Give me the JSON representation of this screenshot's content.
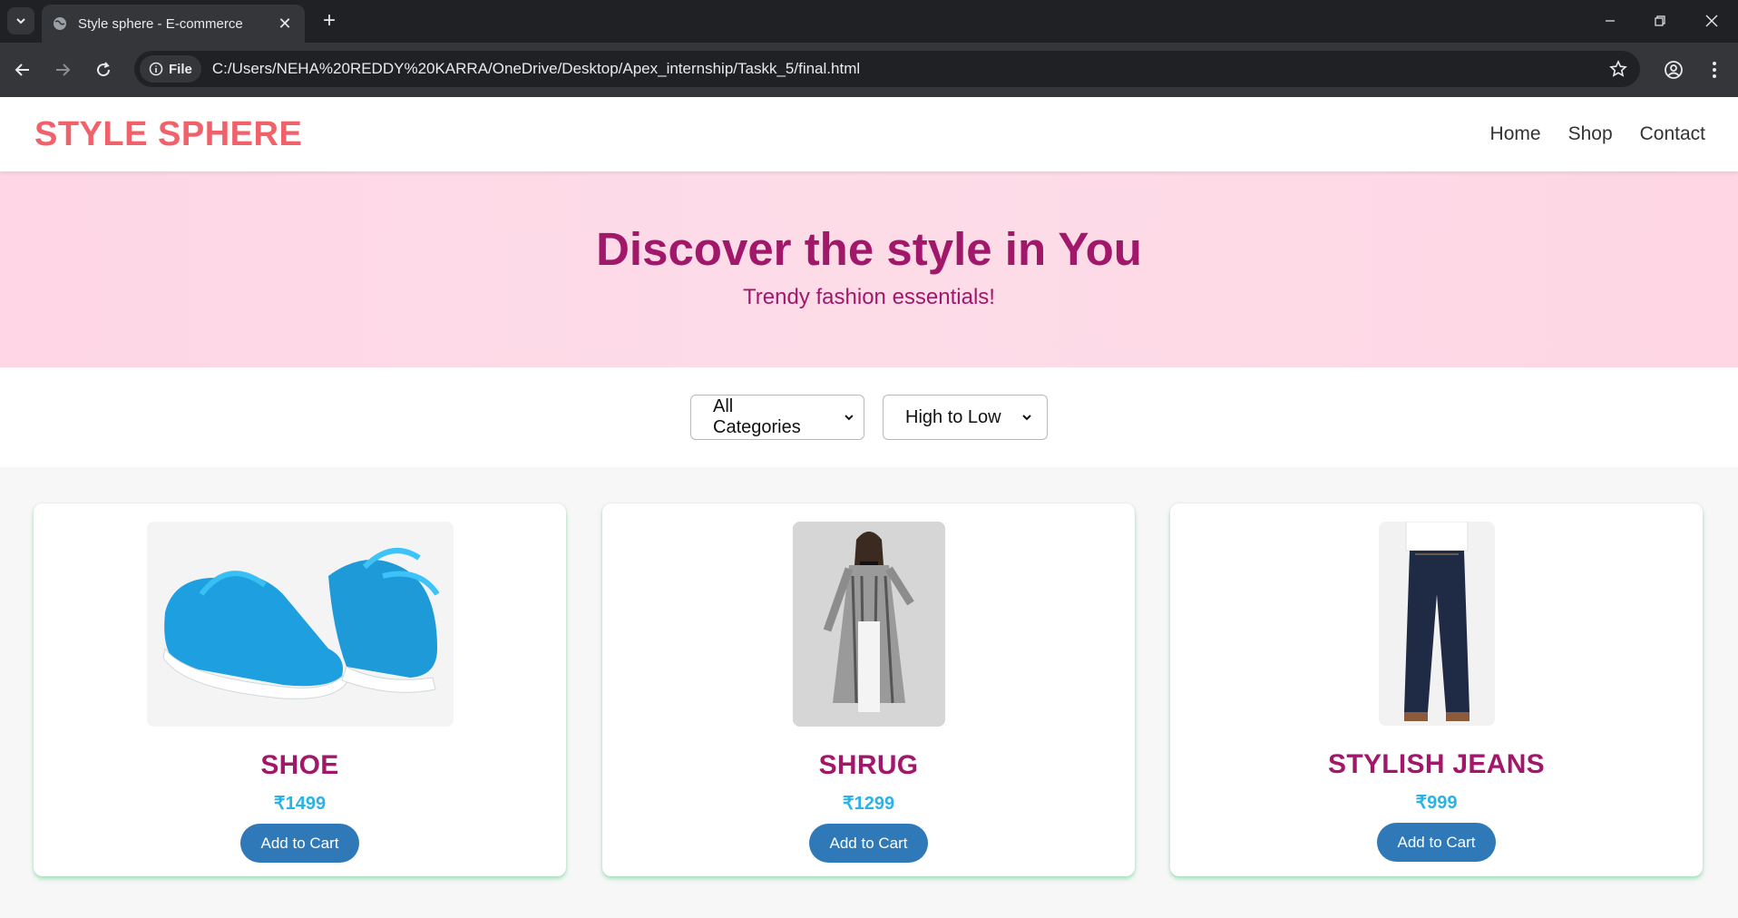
{
  "browser": {
    "tab_title": "Style sphere - E-commerce",
    "file_chip": "File",
    "url": "C:/Users/NEHA%20REDDY%20KARRA/OneDrive/Desktop/Apex_internship/Taskk_5/final.html"
  },
  "header": {
    "logo": "STYLE SPHERE",
    "nav": [
      "Home",
      "Shop",
      "Contact"
    ]
  },
  "hero": {
    "title": "Discover the style in You",
    "subtitle": "Trendy fashion essentials!"
  },
  "filters": {
    "category": "All Categories",
    "sort": "High to Low"
  },
  "products": [
    {
      "name": "SHOE",
      "price": "₹1499",
      "button": "Add to Cart"
    },
    {
      "name": "SHRUG",
      "price": "₹1299",
      "button": "Add to Cart"
    },
    {
      "name": "STYLISH JEANS",
      "price": "₹999",
      "button": "Add to Cart"
    }
  ],
  "colors": {
    "logo": "#f0616a",
    "accent": "#a1186a",
    "price": "#2bb3e6",
    "button": "#2f79b9"
  }
}
